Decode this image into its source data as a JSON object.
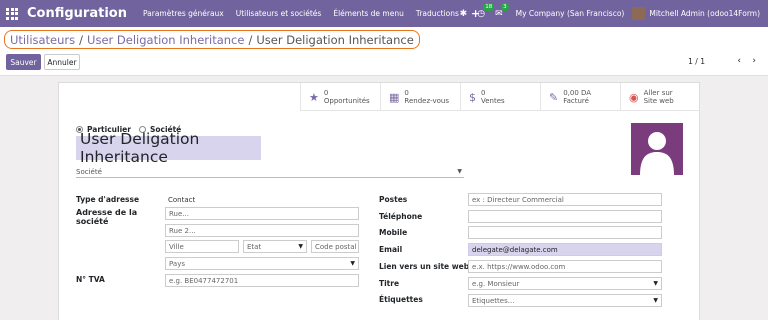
{
  "navbar": {
    "title": "Configuration",
    "menu": [
      "Paramètres généraux",
      "Utilisateurs et sociétés",
      "Éléments de menu",
      "Traductions"
    ],
    "plus": "+",
    "activity_badge": "18",
    "chat_badge": "3",
    "company": "My Company (San Francisco)",
    "user": "Mitchell Admin (odoo14Form)",
    "accent_color": "#71639e"
  },
  "breadcrumb": {
    "items": [
      "Utilisateurs",
      "User Deligation Inheritance",
      "User Deligation Inheritance"
    ],
    "separator": "/",
    "highlight_color": "#e8761e"
  },
  "actions": {
    "save": "Sauver",
    "cancel": "Annuler"
  },
  "pager": {
    "value": "1 / 1",
    "prev": "‹",
    "next": "›"
  },
  "smart_buttons": [
    {
      "icon": "star-icon",
      "glyph": "★",
      "value": "0",
      "label": "Opportunités"
    },
    {
      "icon": "calendar-icon",
      "glyph": "▦",
      "value": "0",
      "label": "Rendez-vous"
    },
    {
      "icon": "dollar-icon",
      "glyph": "$",
      "value": "0",
      "label": "Ventes"
    },
    {
      "icon": "edit-icon",
      "glyph": "✎",
      "value": "0,00 DA",
      "label": "Facturé"
    },
    {
      "icon": "globe-icon",
      "glyph": "◉",
      "value": "Aller sur",
      "label": "Site web"
    }
  ],
  "partner": {
    "type_individual": "Particulier",
    "type_company": "Société",
    "name": "User Deligation Inheritance",
    "company_placeholder": "Société"
  },
  "address": {
    "type_label": "Type d'adresse",
    "type_value": "Contact",
    "address_label_1": "Adresse de la",
    "address_label_2": "société",
    "street_placeholder": "Rue...",
    "street2_placeholder": "Rue 2...",
    "city_placeholder": "Ville",
    "state_placeholder": "Etat",
    "zip_placeholder": "Code postal",
    "country_placeholder": "Pays",
    "vat_label": "N° TVA",
    "vat_placeholder": "e.g. BE0477472701"
  },
  "contact": {
    "function_label": "Postes",
    "function_placeholder": "ex : Directeur Commercial",
    "phone_label": "Téléphone",
    "mobile_label": "Mobile",
    "email_label": "Email",
    "email_value": "delegate@delagate.com",
    "website_label": "Lien vers un site web",
    "website_placeholder": "e.x. https://www.odoo.com",
    "title_label": "Titre",
    "title_placeholder": "e.g. Monsieur",
    "tags_label": "Étiquettes",
    "tags_placeholder": "Etiquettes..."
  }
}
